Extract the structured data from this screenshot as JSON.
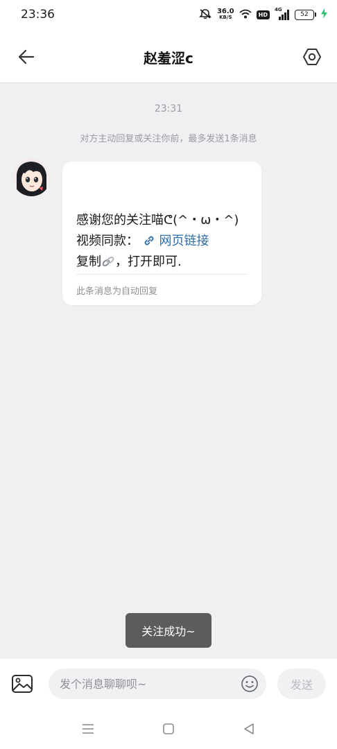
{
  "status_bar": {
    "time": "23:36",
    "net_speed_value": "36.0",
    "net_speed_unit": "KB/S",
    "hd_label": "HD",
    "signal_label": "4G",
    "battery_level": "52",
    "icons": [
      "mute-icon",
      "wifi-icon",
      "signal-icon",
      "battery-icon",
      "charging-icon"
    ]
  },
  "header": {
    "title": "赵羞涩c",
    "back_icon": "arrow-left-icon",
    "settings_icon": "settings-icon"
  },
  "chat": {
    "timestamp": "23:31",
    "notice": "对方主动回复或关注你前，最多发送1条消息",
    "messages": [
      {
        "sender_avatar": "anime-girl-avatar",
        "line1": "感谢您的关注喵ᕦ(^・ω・^)",
        "line2_prefix": "视频同款：",
        "link_icon": "link-icon",
        "link_text": "网页链接",
        "line3_prefix": "复制",
        "line3_suffix": "，打开即可.",
        "footer": "此条消息为自动回复"
      }
    ]
  },
  "toast": {
    "text": "关注成功~"
  },
  "input_bar": {
    "image_icon": "image-icon",
    "placeholder": "发个消息聊聊呗~",
    "emoji_icon": "emoji-icon",
    "send_label": "发送"
  },
  "system_nav": {
    "icons": [
      "menu-icon",
      "home-icon",
      "back-triangle-icon"
    ]
  },
  "colors": {
    "background": "#eef0f2",
    "link": "#2d6ea8",
    "toast": "#5c5c5c",
    "muted_text": "#9a9ca1"
  }
}
